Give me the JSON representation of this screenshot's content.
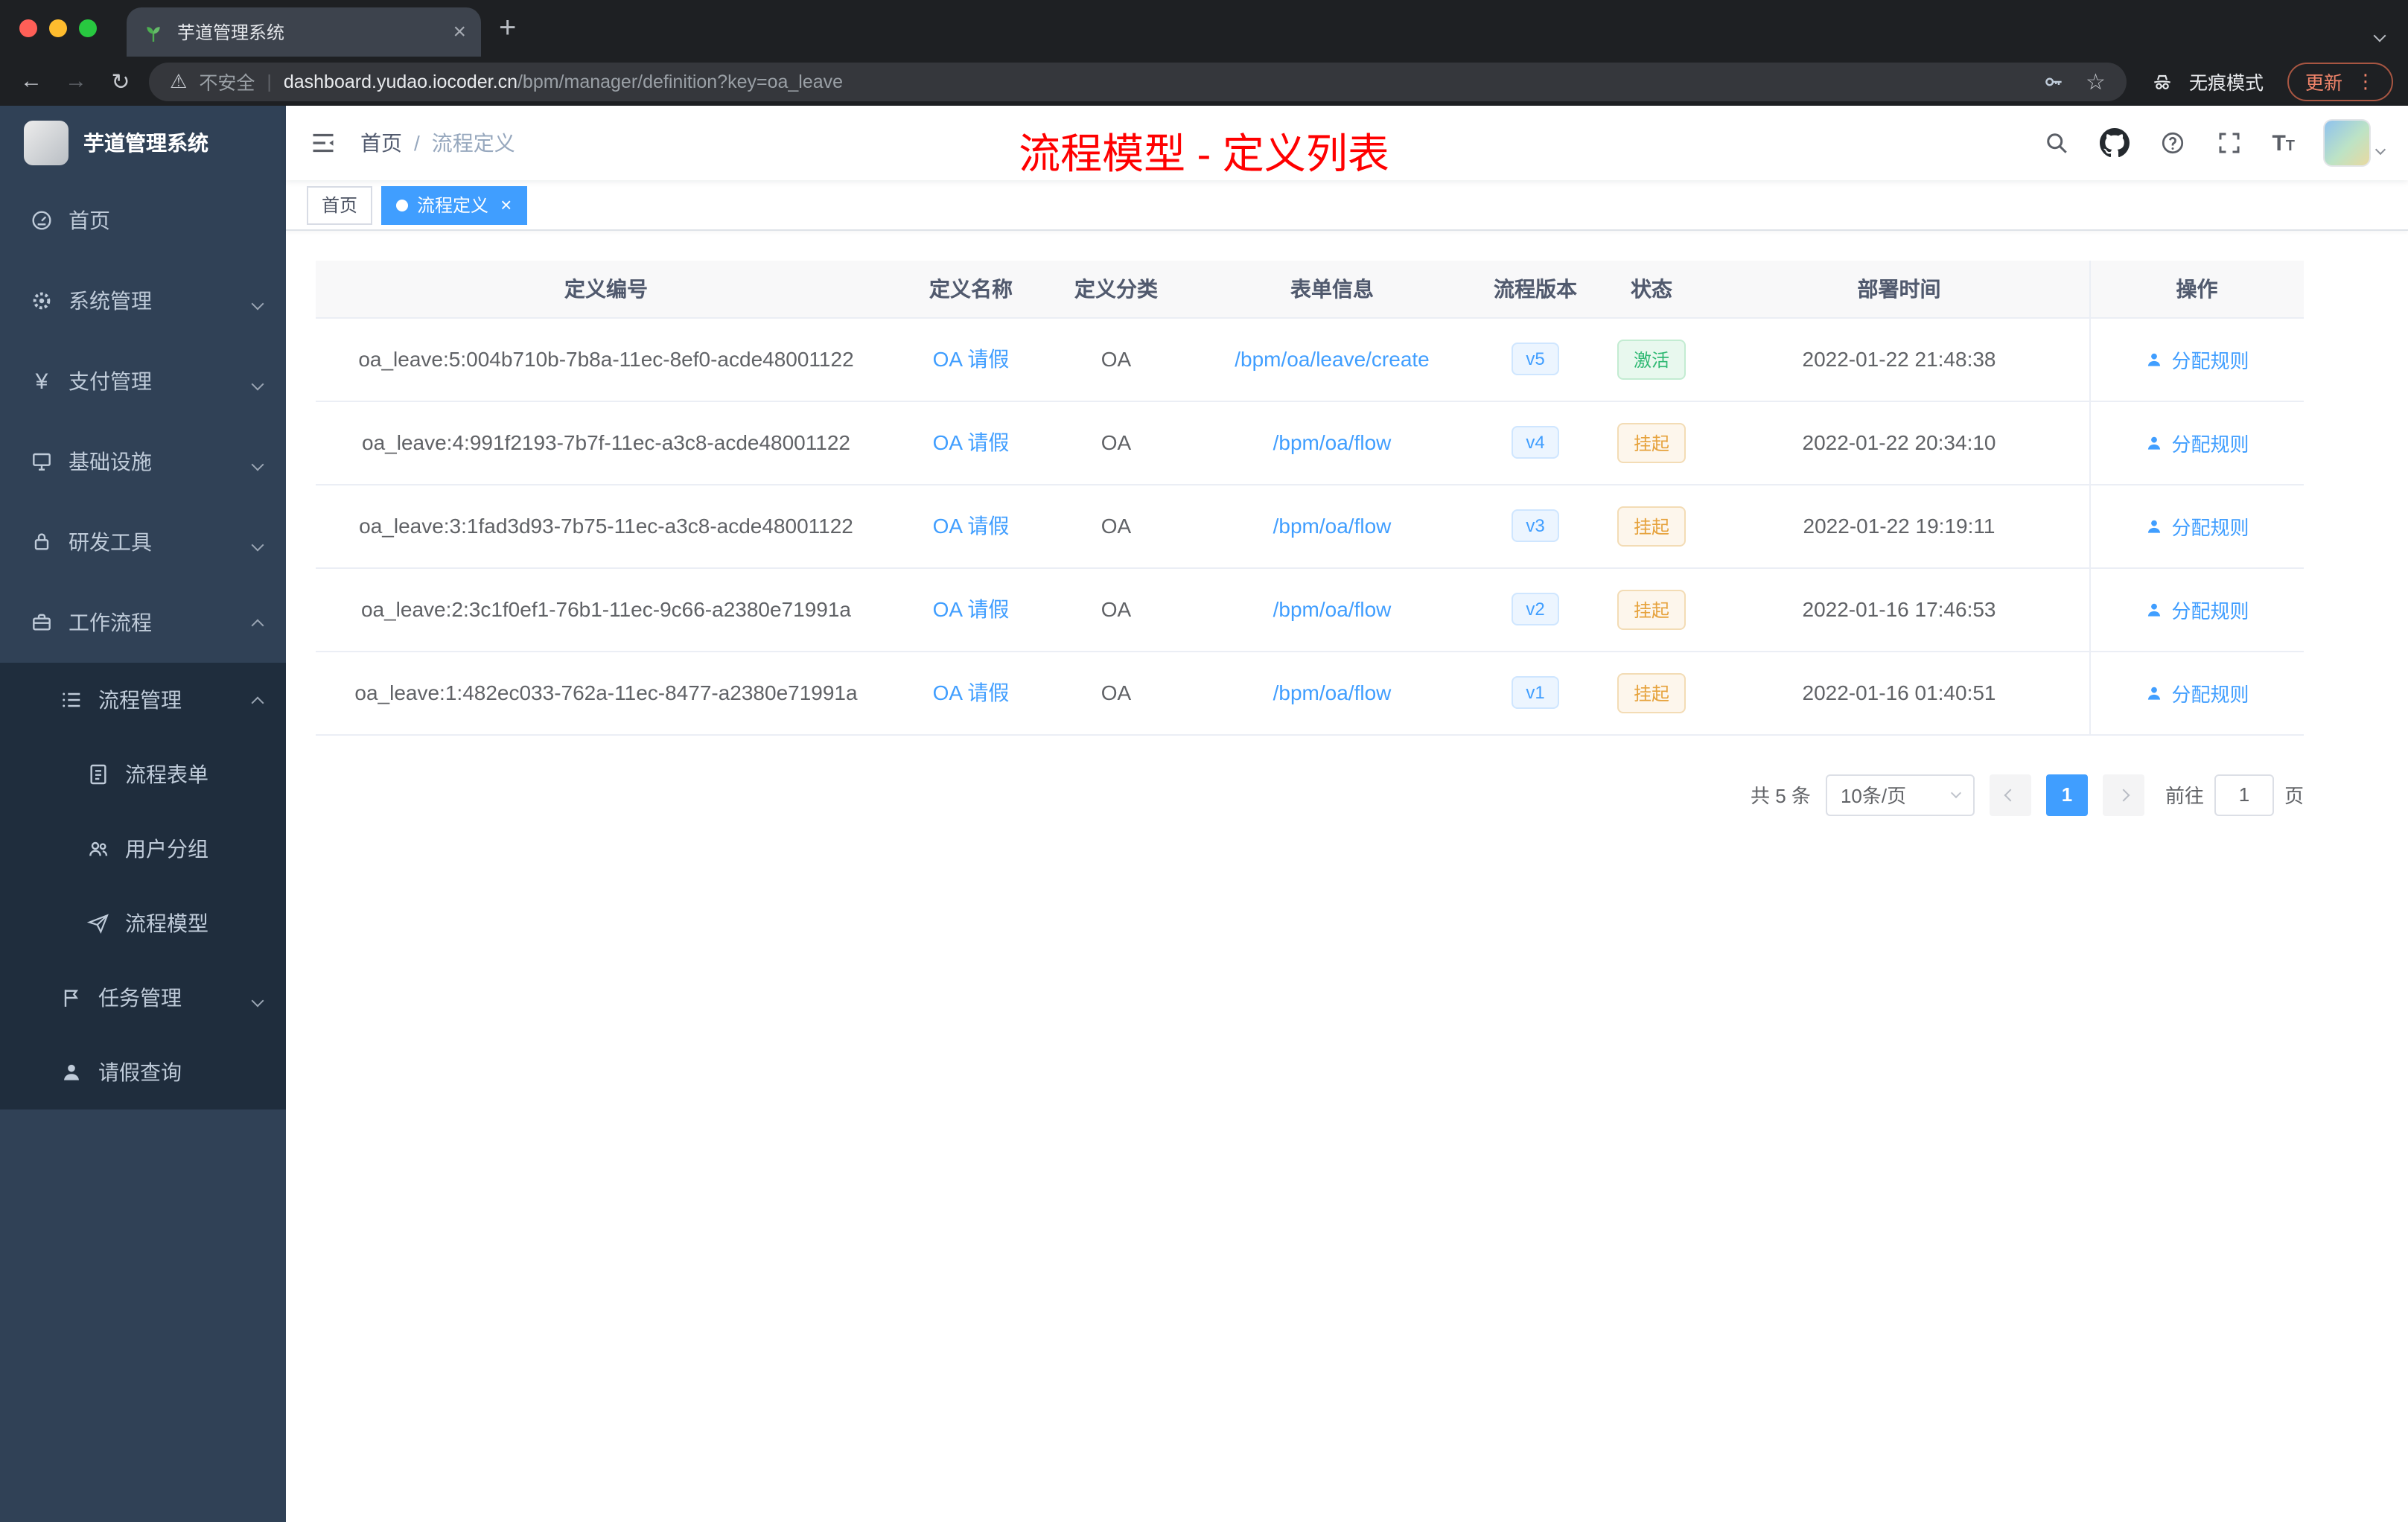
{
  "colors": {
    "accent": "#409eff",
    "page_title": "#ff0000",
    "sidebar_bg": "#304156",
    "sidebar_submenu_bg": "#1f2d3d",
    "status_active": "#2eb872",
    "status_suspended": "#e6a23c"
  },
  "browser": {
    "tab_title": "芋道管理系统",
    "security_label": "不安全",
    "url_domain": "dashboard.yudao.iocoder.cn",
    "url_path": "/bpm/manager/definition?key=oa_leave",
    "incognito_label": "无痕模式",
    "update_label": "更新"
  },
  "icons": {
    "tab_close": "×",
    "new_tab": "+",
    "back": "←",
    "forward": "→",
    "reload": "↻",
    "warning": "⚠",
    "bookmark_star": "☆",
    "overflow_dots": "⋮",
    "omnibox_separator": "|",
    "breadcrumb_separator": "/",
    "font_size_big": "T",
    "font_size_small": "T",
    "yen": "¥"
  },
  "sidebar": {
    "logo_title": "芋道管理系统",
    "items": [
      {
        "label": "首页"
      },
      {
        "label": "系统管理"
      },
      {
        "label": "支付管理"
      },
      {
        "label": "基础设施"
      },
      {
        "label": "研发工具"
      },
      {
        "label": "工作流程"
      }
    ],
    "sub": {
      "process_mgmt": "流程管理",
      "process_form": "流程表单",
      "user_group": "用户分组",
      "process_model": "流程模型",
      "task_mgmt": "任务管理",
      "leave_query": "请假查询"
    }
  },
  "header": {
    "breadcrumb": [
      "首页",
      "流程定义"
    ],
    "page_title": "流程模型 - 定义列表"
  },
  "tags": [
    {
      "label": "首页"
    },
    {
      "label": "流程定义"
    }
  ],
  "table": {
    "columns": [
      "定义编号",
      "定义名称",
      "定义分类",
      "表单信息",
      "流程版本",
      "状态",
      "部署时间",
      "操作"
    ],
    "rows": [
      {
        "id": "oa_leave:5:004b710b-7b8a-11ec-8ef0-acde48001122",
        "name": "OA 请假",
        "category": "OA",
        "form": "/bpm/oa/leave/create",
        "version": "v5",
        "status": "激活",
        "time": "2022-01-22 21:48:38",
        "action": "分配规则"
      },
      {
        "id": "oa_leave:4:991f2193-7b7f-11ec-a3c8-acde48001122",
        "name": "OA 请假",
        "category": "OA",
        "form": "/bpm/oa/flow",
        "version": "v4",
        "status": "挂起",
        "time": "2022-01-22 20:34:10",
        "action": "分配规则"
      },
      {
        "id": "oa_leave:3:1fad3d93-7b75-11ec-a3c8-acde48001122",
        "name": "OA 请假",
        "category": "OA",
        "form": "/bpm/oa/flow",
        "version": "v3",
        "status": "挂起",
        "time": "2022-01-22 19:19:11",
        "action": "分配规则"
      },
      {
        "id": "oa_leave:2:3c1f0ef1-76b1-11ec-9c66-a2380e71991a",
        "name": "OA 请假",
        "category": "OA",
        "form": "/bpm/oa/flow",
        "version": "v2",
        "status": "挂起",
        "time": "2022-01-16 17:46:53",
        "action": "分配规则"
      },
      {
        "id": "oa_leave:1:482ec033-762a-11ec-8477-a2380e71991a",
        "name": "OA 请假",
        "category": "OA",
        "form": "/bpm/oa/flow",
        "version": "v1",
        "status": "挂起",
        "time": "2022-01-16 01:40:51",
        "action": "分配规则"
      }
    ]
  },
  "pagination": {
    "total": "共 5 条",
    "page_size": "10条/页",
    "page": "1",
    "goto": "前往",
    "goto_value": "1",
    "unit": "页"
  }
}
